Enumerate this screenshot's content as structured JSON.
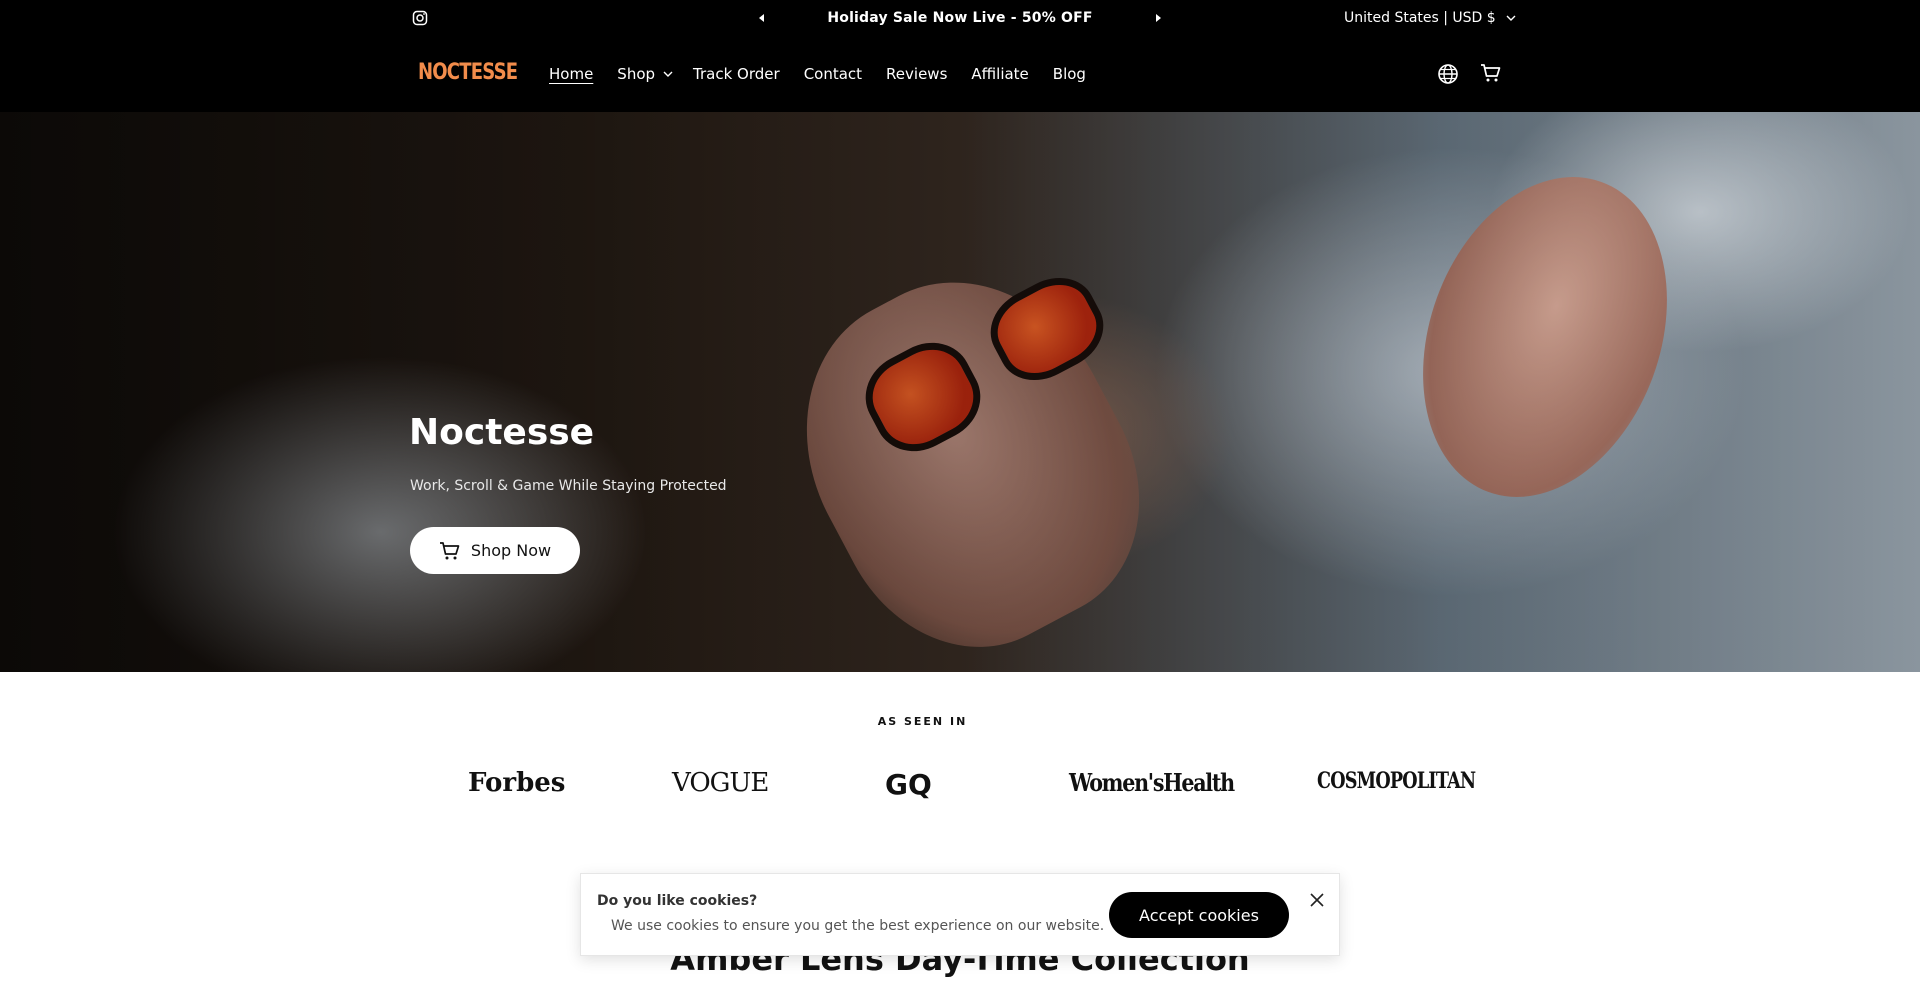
{
  "announcement": {
    "message": "Holiday Sale Now Live - 50% OFF",
    "locale": "United States | USD $",
    "icons": [
      "instagram-icon",
      "arrow-left-icon",
      "arrow-right-icon",
      "chevron-down-icon"
    ]
  },
  "header": {
    "logo": "NOCTESSE",
    "nav": [
      {
        "label": "Home",
        "active": true
      },
      {
        "label": "Shop",
        "has_dropdown": true
      },
      {
        "label": "Track Order"
      },
      {
        "label": "Contact"
      },
      {
        "label": "Reviews"
      },
      {
        "label": "Affiliate"
      },
      {
        "label": "Blog"
      }
    ],
    "icons": [
      "globe-icon",
      "cart-icon"
    ]
  },
  "hero": {
    "title": "Noctesse",
    "subtitle": "Work, Scroll & Game While Staying Protected",
    "cta_label": "Shop Now"
  },
  "press": {
    "heading": "AS SEEN IN",
    "logos": [
      "Forbes",
      "VOGUE",
      "GQ",
      "Women'sHealth",
      "COSMOPOLITAN"
    ]
  },
  "section": {
    "title": "Amber Lens Day-Time Collection"
  },
  "cookie": {
    "question": "Do you like cookies?",
    "text": "We use cookies to ensure you get the best experience on our website.",
    "accept_label": "Accept cookies"
  },
  "colors": {
    "announcement_bg": "#000000",
    "logo_accent": "#f28c4b",
    "button_dark": "#000000"
  }
}
